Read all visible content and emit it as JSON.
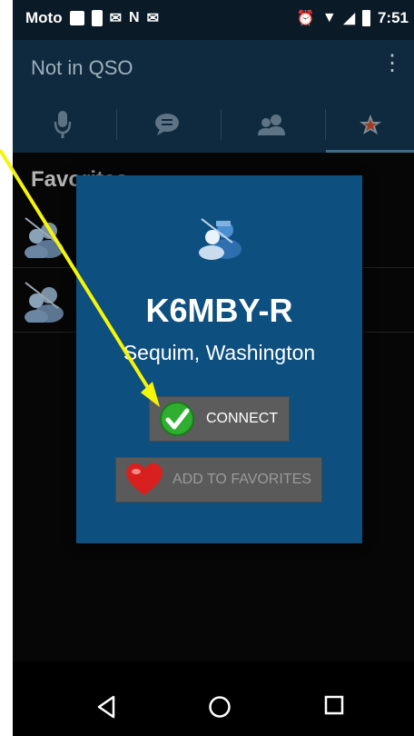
{
  "status_bar": {
    "carrier": "Moto",
    "time": "7:51"
  },
  "app_bar": {
    "title": "Not in QSO"
  },
  "tabs": [
    {
      "icon": "microphone-icon"
    },
    {
      "icon": "chat-icon"
    },
    {
      "icon": "people-icon"
    },
    {
      "icon": "star-icon",
      "selected": true
    }
  ],
  "favorites": {
    "title": "Favorites"
  },
  "dialog": {
    "callsign": "K6MBY-R",
    "location": "Sequim, Washington",
    "connect_label": "CONNECT",
    "favorite_label": "ADD TO FAVORITES"
  },
  "colors": {
    "dialog_bg": "#0d4f7f",
    "app_bar": "#0f2a3e",
    "arrow": "#f5f50a"
  }
}
